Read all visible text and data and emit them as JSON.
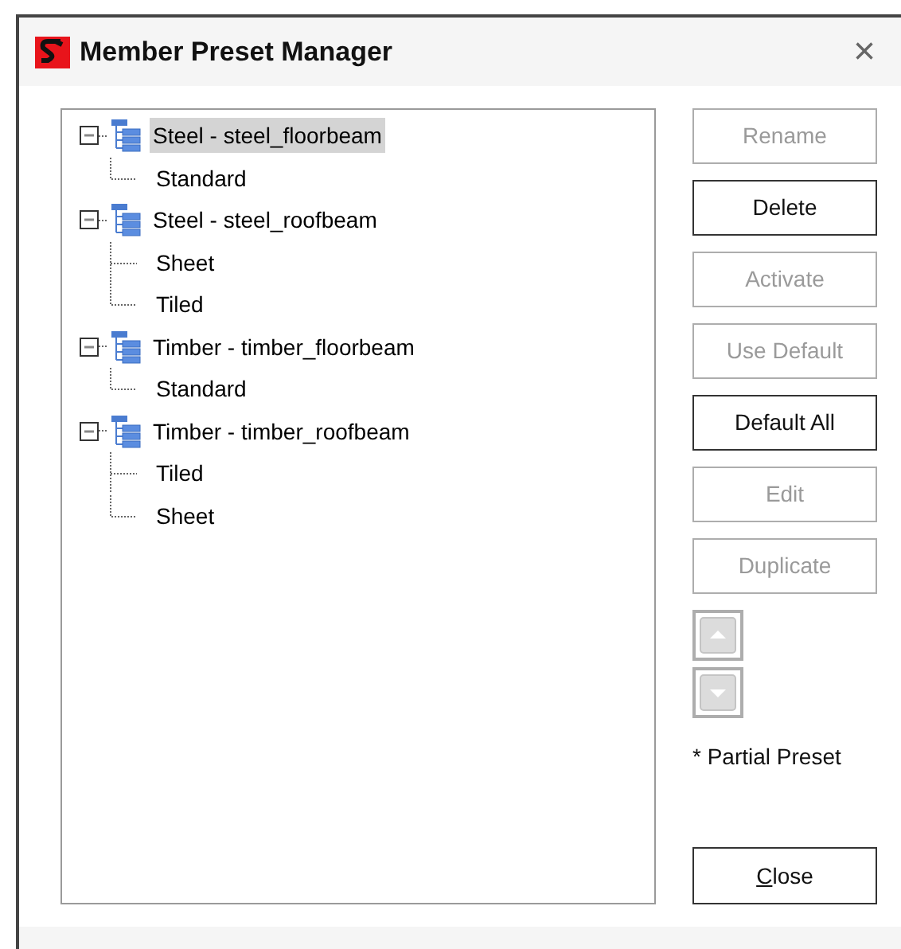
{
  "window": {
    "title": "Member Preset Manager",
    "close_glyph": "×"
  },
  "tree": [
    {
      "label": "Steel - steel_floorbeam",
      "expanded": true,
      "selected": true,
      "children": [
        {
          "label": "Standard",
          "selected": false
        }
      ]
    },
    {
      "label": "Steel - steel_roofbeam",
      "expanded": true,
      "selected": false,
      "children": [
        {
          "label": "Sheet",
          "selected": false
        },
        {
          "label": "Tiled",
          "selected": false
        }
      ]
    },
    {
      "label": "Timber - timber_floorbeam",
      "expanded": true,
      "selected": false,
      "children": [
        {
          "label": "Standard",
          "selected": false
        }
      ]
    },
    {
      "label": "Timber - timber_roofbeam",
      "expanded": true,
      "selected": false,
      "children": [
        {
          "label": "Tiled",
          "selected": false
        },
        {
          "label": "Sheet",
          "selected": false
        }
      ]
    }
  ],
  "buttons": [
    {
      "label": "Rename",
      "disabled": true
    },
    {
      "label": "Delete",
      "disabled": false
    },
    {
      "label": "Activate",
      "disabled": true
    },
    {
      "label": "Use Default",
      "disabled": true
    },
    {
      "label": "Default All",
      "disabled": false
    },
    {
      "label": "Edit",
      "disabled": true
    },
    {
      "label": "Duplicate",
      "disabled": true
    }
  ],
  "move_buttons": [
    {
      "kind": "up",
      "disabled": true
    },
    {
      "kind": "down",
      "disabled": true
    }
  ],
  "legend": "* Partial Preset",
  "close_button": {
    "label": "Close",
    "underline_first": true
  }
}
